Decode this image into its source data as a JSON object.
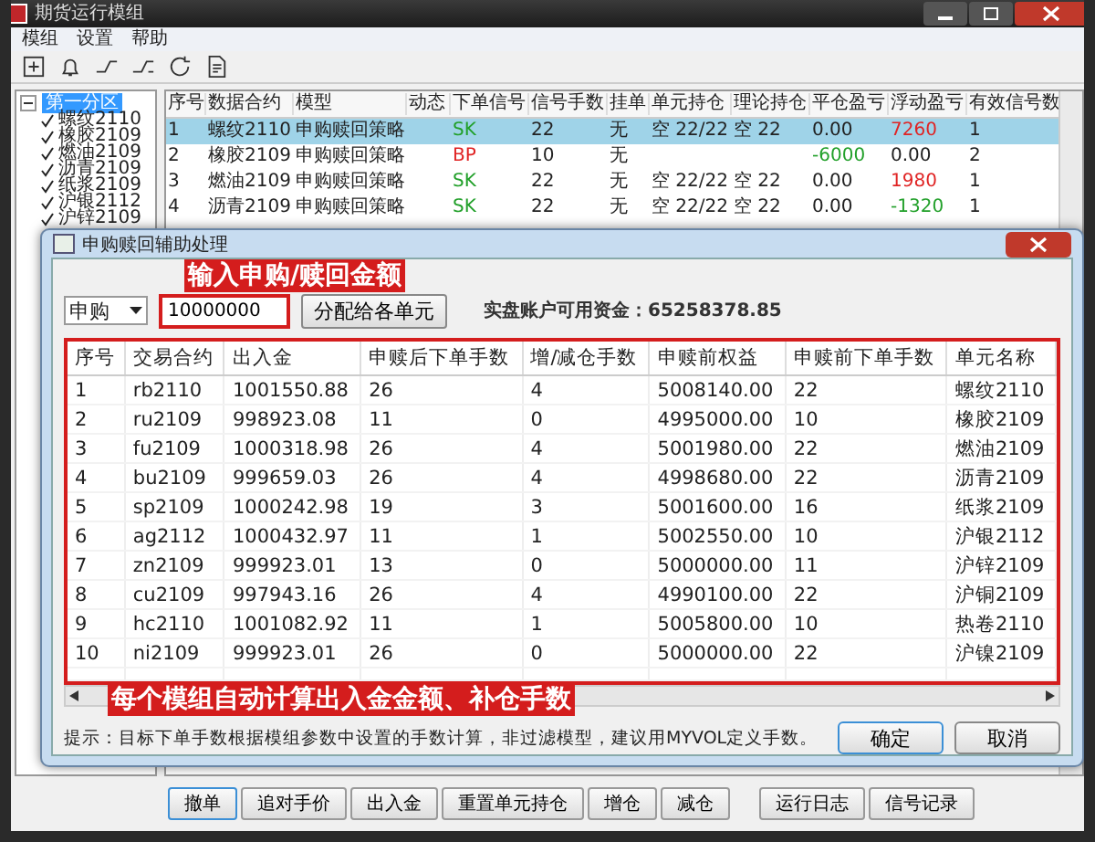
{
  "window": {
    "title": "期货运行模组"
  },
  "menu": [
    "模组",
    "设置",
    "帮助"
  ],
  "tree": {
    "label": "第一分区",
    "selected": true,
    "expanded": true,
    "children": [
      {
        "label": "螺纹2110",
        "checked": true
      },
      {
        "label": "橡胶2109",
        "checked": true
      },
      {
        "label": "燃油2109",
        "checked": true
      },
      {
        "label": "沥青2109",
        "checked": true
      },
      {
        "label": "纸浆2109",
        "checked": true
      },
      {
        "label": "沪银2112",
        "checked": true
      },
      {
        "label": "沪锌2109",
        "checked": true
      }
    ]
  },
  "table": {
    "columns": [
      "序号",
      "数据合约",
      "模型",
      "动态",
      "下单信号",
      "信号手数",
      "挂单",
      "单元持仓",
      "理论持仓",
      "平仓盈亏",
      "浮动盈亏",
      "有效信号数"
    ],
    "rows": [
      {
        "selected": true,
        "cells": [
          "1",
          "螺纹2110",
          "申购赎回策略",
          "",
          {
            "text": "SK",
            "color": "#22a02a"
          },
          "22",
          "无",
          "空 22/22",
          "空 22",
          {
            "text": "0.00",
            "color": "#202020"
          },
          {
            "text": "7260",
            "color": "#e02424"
          },
          "1"
        ]
      },
      {
        "selected": false,
        "cells": [
          "2",
          "橡胶2109",
          "申购赎回策略",
          "",
          {
            "text": "BP",
            "color": "#e02424"
          },
          "10",
          "无",
          "",
          "",
          {
            "text": "-6000",
            "color": "#22a02a"
          },
          {
            "text": "0.00",
            "color": "#202020"
          },
          "2"
        ]
      },
      {
        "selected": false,
        "cells": [
          "3",
          "燃油2109",
          "申购赎回策略",
          "",
          {
            "text": "SK",
            "color": "#22a02a"
          },
          "22",
          "无",
          "空 22/22",
          "空 22",
          {
            "text": "0.00",
            "color": "#202020"
          },
          {
            "text": "1980",
            "color": "#e02424"
          },
          "1"
        ]
      },
      {
        "selected": false,
        "cells": [
          "4",
          "沥青2109",
          "申购赎回策略",
          "",
          {
            "text": "SK",
            "color": "#22a02a"
          },
          "22",
          "无",
          "空 22/22",
          "空 22",
          {
            "text": "0.00",
            "color": "#202020"
          },
          {
            "text": "-1320",
            "color": "#22a02a"
          },
          "1"
        ]
      }
    ]
  },
  "buttons": [
    "撤单",
    "追对手价",
    "出入金",
    "重置单元持仓",
    "增仓",
    "减仓"
  ],
  "log_buttons": [
    "运行日志",
    "信号记录"
  ],
  "dialog": {
    "title": "申购赎回辅助处理",
    "annotation_top": "输入申购/赎回金额",
    "mode": "申购",
    "amount": "10000000",
    "distribute_button": "分配给各单元",
    "balance": "实盘账户可用资金：65258378.85",
    "columns": [
      "序号",
      "交易合约",
      "出入金",
      "申赎后下单手数",
      "增/减仓手数",
      "申赎前权益",
      "申赎前下单手数",
      "单元名称"
    ],
    "rows": [
      [
        "1",
        "rb2110",
        "1001550.88",
        "26",
        "4",
        "5008140.00",
        "22",
        "螺纹2110"
      ],
      [
        "2",
        "ru2109",
        "998923.08",
        "11",
        "0",
        "4995000.00",
        "10",
        "橡胶2109"
      ],
      [
        "3",
        "fu2109",
        "1000318.98",
        "26",
        "4",
        "5001980.00",
        "22",
        "燃油2109"
      ],
      [
        "4",
        "bu2109",
        "999659.03",
        "26",
        "4",
        "4998680.00",
        "22",
        "沥青2109"
      ],
      [
        "5",
        "sp2109",
        "1000242.98",
        "19",
        "3",
        "5001600.00",
        "16",
        "纸浆2109"
      ],
      [
        "6",
        "ag2112",
        "1000432.97",
        "11",
        "1",
        "5002550.00",
        "10",
        "沪银2112"
      ],
      [
        "7",
        "zn2109",
        "999923.01",
        "13",
        "0",
        "5000000.00",
        "11",
        "沪锌2109"
      ],
      [
        "8",
        "cu2109",
        "997943.16",
        "26",
        "4",
        "4990100.00",
        "22",
        "沪铜2109"
      ],
      [
        "9",
        "hc2110",
        "1001082.92",
        "11",
        "1",
        "5005800.00",
        "10",
        "热卷2110"
      ],
      [
        "10",
        "ni2109",
        "999923.01",
        "26",
        "0",
        "5000000.00",
        "22",
        "沪镍2109"
      ]
    ],
    "annotation_bottom": "每个模组自动计算出入金金额、补仓手数",
    "hint": "提示：目标下单手数根据模组参数中设置的手数计算，非过滤模型，建议用MYVOL定义手数。",
    "ok": "确定",
    "cancel": "取消"
  }
}
